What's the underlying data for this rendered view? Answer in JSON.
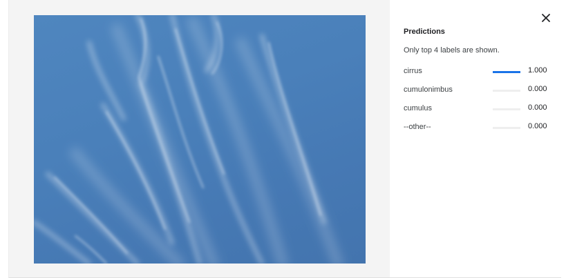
{
  "close_icon": "close-icon",
  "panel": {
    "title": "Predictions",
    "subtitle": "Only top 4 labels are shown."
  },
  "predictions": [
    {
      "label": "cirrus",
      "value": "1.000",
      "score": 1.0
    },
    {
      "label": "cumulonimbus",
      "value": "0.000",
      "score": 0.0
    },
    {
      "label": "cumulus",
      "value": "0.000",
      "score": 0.0
    },
    {
      "label": "--other--",
      "value": "0.000",
      "score": 0.0
    }
  ],
  "colors": {
    "bar_fill": "#1a73e8",
    "bar_track": "#eeeeee",
    "image_pane_bg": "#f4f4f4"
  }
}
